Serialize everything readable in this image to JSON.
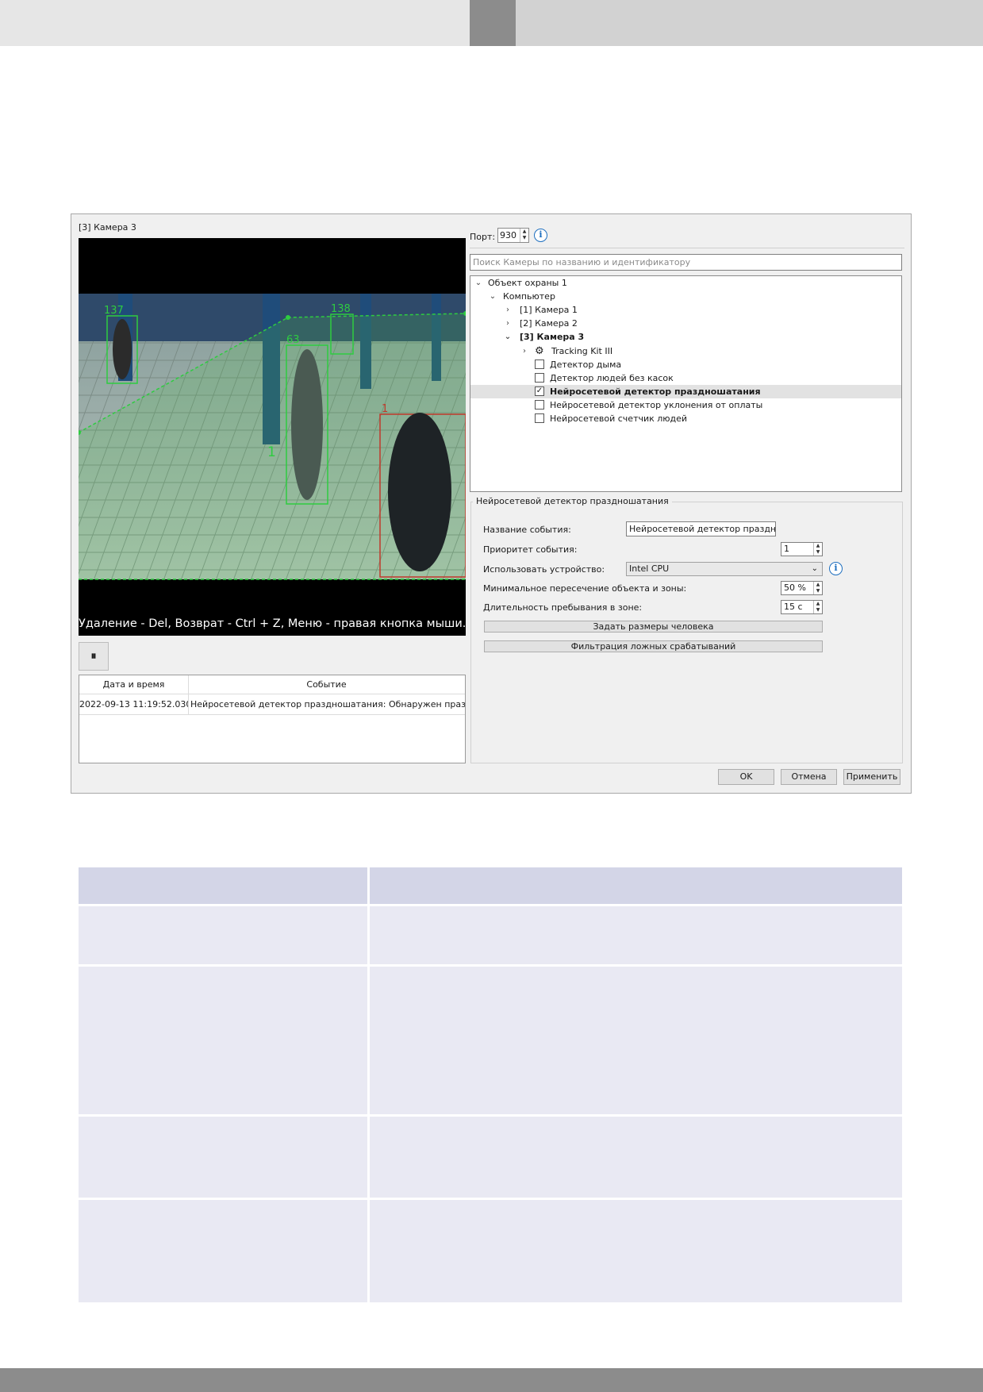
{
  "dialog": {
    "camera_title": "[3] Камера 3",
    "video_caption": "Удаление - Del, Возврат - Ctrl + Z, Меню - правая кнопка мыши.",
    "track_labels": [
      "137",
      "138",
      "63",
      "1",
      "1"
    ],
    "pause_label": "⏸",
    "events": {
      "columns": [
        "Дата и время",
        "Событие"
      ],
      "rows": [
        {
          "time": "2022-09-13 11:19:52.030",
          "event": "Нейросетевой детектор праздношатания: Обнаружен праздн..."
        }
      ]
    },
    "port": {
      "label": "Порт:",
      "value": "930"
    },
    "search": {
      "placeholder": "Поиск Камеры по названию и идентификатору"
    },
    "tree": [
      {
        "label": "Объект охраны 1",
        "expanded": true
      },
      {
        "label": "Компьютер",
        "expanded": true
      },
      {
        "label": "[1] Камера 1",
        "expanded": false
      },
      {
        "label": "[2] Камера 2",
        "expanded": false
      },
      {
        "label": "[3] Камера 3",
        "expanded": true
      },
      {
        "label": "Tracking Kit III",
        "expanded": false
      },
      {
        "label": "Детектор дыма",
        "checked": false
      },
      {
        "label": "Детектор людей без касок",
        "checked": false
      },
      {
        "label": "Нейросетевой детектор праздношатания",
        "checked": true
      },
      {
        "label": "Нейросетевой детектор уклонения от оплаты",
        "checked": false
      },
      {
        "label": "Нейросетевой счетчик людей",
        "checked": false
      }
    ],
    "settings": {
      "group_title": "Нейросетевой детектор праздношатания",
      "event_name_label": "Название события:",
      "event_name_value": "Нейросетевой детектор праздношатания",
      "priority_label": "Приоритет события:",
      "priority_value": "1",
      "device_label": "Использовать устройство:",
      "device_value": "Intel CPU",
      "intersection_label": "Минимальное пересечение объекта и зоны:",
      "intersection_value": "50 %",
      "duration_label": "Длительность пребывания в зоне:",
      "duration_value": "15 с",
      "person_size_button": "Задать размеры человека",
      "filter_button": "Фильтрация ложных срабатываний"
    },
    "buttons": {
      "ok": "OK",
      "cancel": "Отмена",
      "apply": "Применить"
    }
  },
  "colors": {
    "header_left": "#e6e6e6",
    "header_accent": "#8c8c8c",
    "header_right": "#d2d2d2",
    "table_header": "#d3d5e7",
    "table_cell": "#e9e9f3",
    "footer": "#8c8c8c",
    "info_blue": "#1e6fbf",
    "track_green": "#2ecc40",
    "track_red": "#c0392b"
  }
}
